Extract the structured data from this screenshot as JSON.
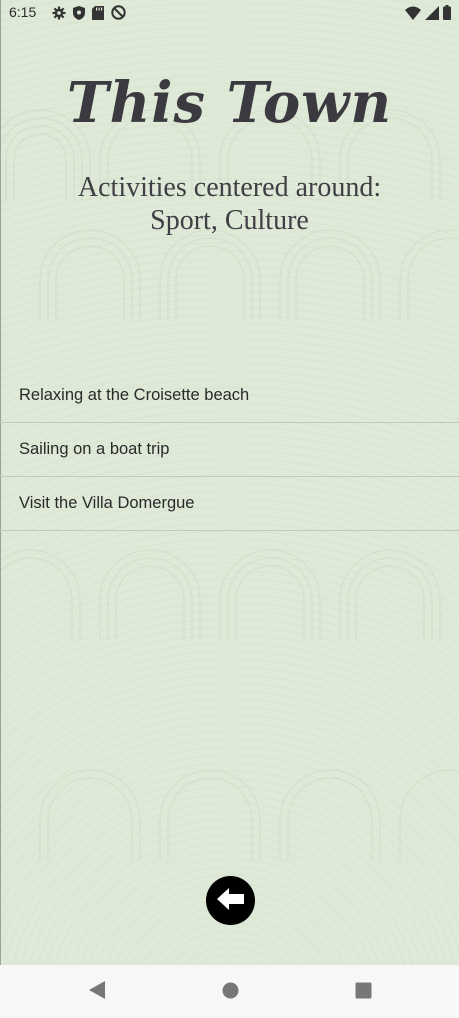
{
  "status_bar": {
    "time": "6:15",
    "left_icons": [
      "settings-icon",
      "shield-icon",
      "sd-card-icon",
      "do-not-disturb-icon"
    ],
    "right_icons": [
      "wifi-icon",
      "signal-icon",
      "battery-icon"
    ]
  },
  "header": {
    "title": "This Town",
    "subtitle_line1": "Activities centered around:",
    "subtitle_line2": "Sport, Culture"
  },
  "activities": [
    {
      "label": "Relaxing at the Croisette beach"
    },
    {
      "label": "Sailing on a boat trip"
    },
    {
      "label": "Visit the Villa Domergue"
    }
  ],
  "back_button": {
    "icon": "arrow-left-icon"
  },
  "navigation_bar": {
    "buttons": [
      "back-triangle-icon",
      "home-circle-icon",
      "recents-square-icon"
    ]
  },
  "colors": {
    "background": "#dfe9d7",
    "title": "#3b3a40",
    "nav_bar": "#f7f7f7"
  }
}
